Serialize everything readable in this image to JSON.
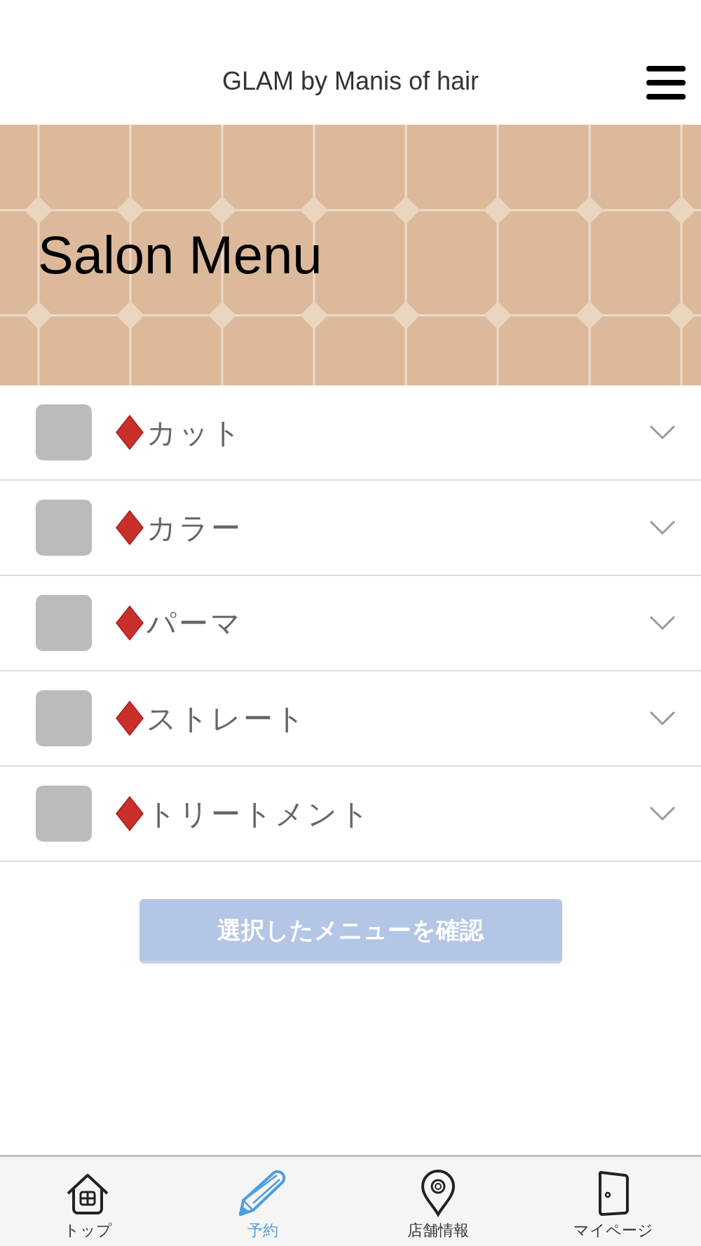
{
  "header": {
    "title": "GLAM by Manis of hair"
  },
  "banner": {
    "title": "Salon Menu"
  },
  "menu_items": [
    {
      "label": "カット",
      "checked": false,
      "expanded": false
    },
    {
      "label": "カラー",
      "checked": false,
      "expanded": false
    },
    {
      "label": "パーマ",
      "checked": false,
      "expanded": false
    },
    {
      "label": "ストレート",
      "checked": false,
      "expanded": false
    },
    {
      "label": "トリートメント",
      "checked": false,
      "expanded": false
    }
  ],
  "confirm_button": {
    "label": "選択したメニューを確認",
    "disabled": true
  },
  "tab_bar": [
    {
      "kind": "home",
      "label": "トップ",
      "selected": false
    },
    {
      "kind": "pencil",
      "label": "予約",
      "selected": true
    },
    {
      "kind": "pin",
      "label": "店舗情報",
      "selected": false
    },
    {
      "kind": "door",
      "label": "マイページ",
      "selected": false
    }
  ]
}
